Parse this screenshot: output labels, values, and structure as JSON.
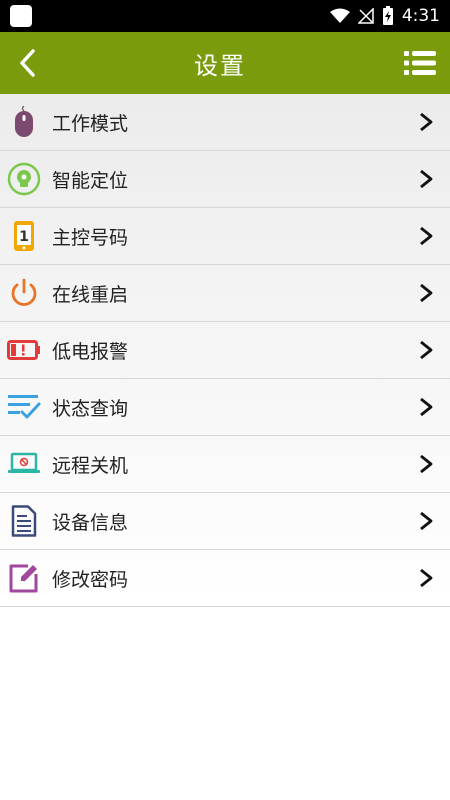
{
  "status_bar": {
    "time": "4:31"
  },
  "header": {
    "title": "设置"
  },
  "menu": [
    {
      "label": "工作模式",
      "icon": "mouse-icon",
      "color": "#7b4a6e"
    },
    {
      "label": "智能定位",
      "icon": "location-icon",
      "color": "#7cc84c"
    },
    {
      "label": "主控号码",
      "icon": "phone-number-icon",
      "color": "#f0a800"
    },
    {
      "label": "在线重启",
      "icon": "power-icon",
      "color": "#e8742a"
    },
    {
      "label": "低电报警",
      "icon": "low-battery-icon",
      "color": "#e23b3b"
    },
    {
      "label": "状态查询",
      "icon": "status-checklist-icon",
      "color": "#3aa2e0"
    },
    {
      "label": "远程关机",
      "icon": "laptop-shutdown-icon",
      "color": "#2bb5a5"
    },
    {
      "label": "设备信息",
      "icon": "document-icon",
      "color": "#3a4a7a"
    },
    {
      "label": "修改密码",
      "icon": "edit-icon",
      "color": "#a0489e"
    }
  ],
  "colors": {
    "accent": "#7a9b0c",
    "status_bar": "#000000"
  }
}
